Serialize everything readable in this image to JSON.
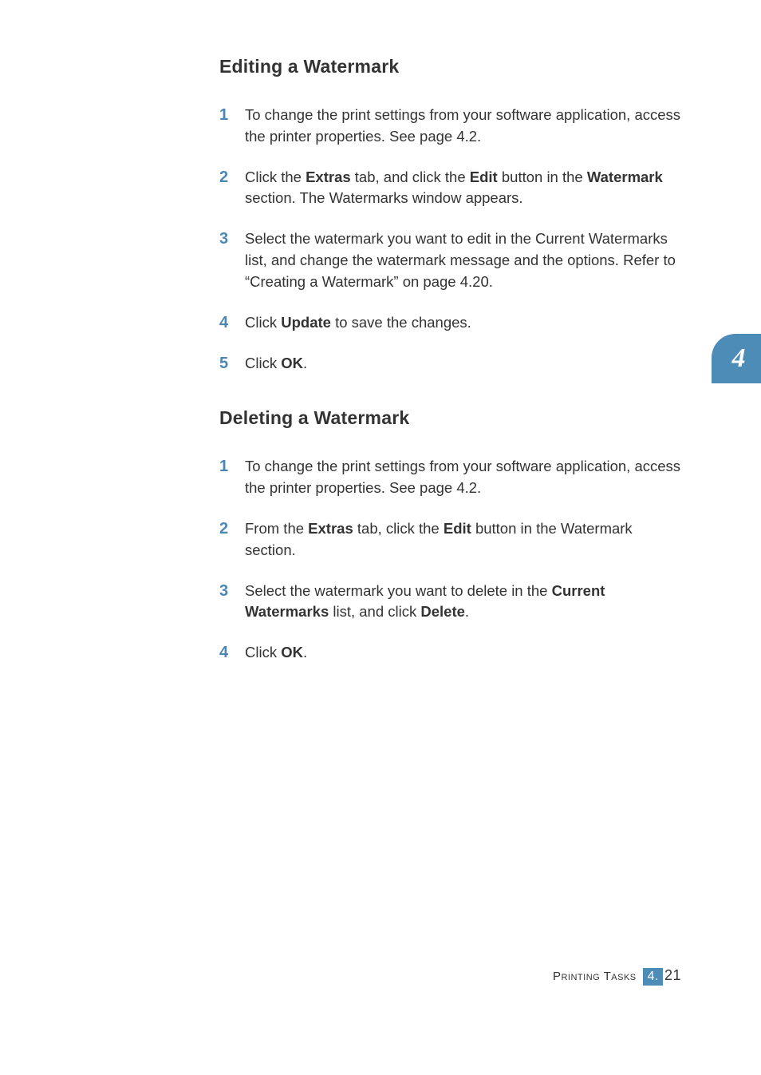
{
  "sideTab": {
    "chapter": "4"
  },
  "sections": [
    {
      "heading": "Editing a Watermark",
      "steps": [
        {
          "num": "1",
          "runs": [
            {
              "t": "To change the print settings from your software application, access the printer properties. See page 4.2."
            }
          ]
        },
        {
          "num": "2",
          "runs": [
            {
              "t": "Click the "
            },
            {
              "t": "Extras",
              "b": true
            },
            {
              "t": " tab, and click the "
            },
            {
              "t": "Edit",
              "b": true
            },
            {
              "t": " button in the "
            },
            {
              "t": "Watermark",
              "b": true
            },
            {
              "t": " section. The Watermarks window appears."
            }
          ]
        },
        {
          "num": "3",
          "runs": [
            {
              "t": "Select the watermark you want to edit in the Current Watermarks list, and change the watermark message and the options. Refer to “Creating a Watermark” on page 4.20."
            }
          ]
        },
        {
          "num": "4",
          "runs": [
            {
              "t": "Click "
            },
            {
              "t": "Update",
              "b": true
            },
            {
              "t": " to save the changes."
            }
          ]
        },
        {
          "num": "5",
          "runs": [
            {
              "t": "Click "
            },
            {
              "t": "OK",
              "b": true
            },
            {
              "t": "."
            }
          ]
        }
      ]
    },
    {
      "heading": "Deleting a Watermark",
      "steps": [
        {
          "num": "1",
          "runs": [
            {
              "t": "To change the print settings from your software application, access the printer properties. See page 4.2."
            }
          ]
        },
        {
          "num": "2",
          "runs": [
            {
              "t": "From the "
            },
            {
              "t": "Extras",
              "b": true
            },
            {
              "t": " tab, click the "
            },
            {
              "t": "Edit",
              "b": true
            },
            {
              "t": " button in the Watermark section."
            }
          ]
        },
        {
          "num": "3",
          "runs": [
            {
              "t": "Select the watermark you want to delete in the "
            },
            {
              "t": "Current Watermarks",
              "b": true
            },
            {
              "t": " list, and click "
            },
            {
              "t": "Delete",
              "b": true
            },
            {
              "t": "."
            }
          ]
        },
        {
          "num": "4",
          "runs": [
            {
              "t": "Click "
            },
            {
              "t": "OK",
              "b": true
            },
            {
              "t": "."
            }
          ]
        }
      ]
    }
  ],
  "footer": {
    "sectionTitle": "Printing Tasks",
    "chapter": "4.",
    "page": "21"
  }
}
